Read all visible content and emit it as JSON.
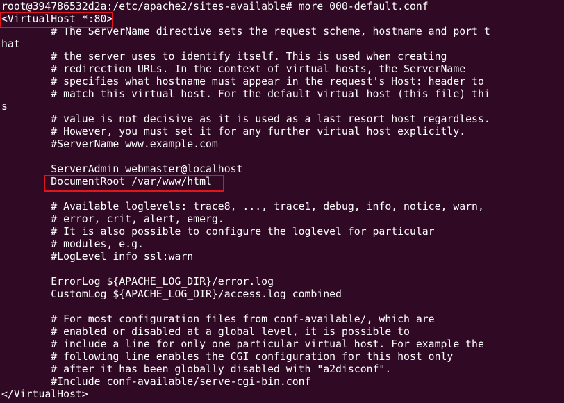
{
  "terminal": {
    "lines": [
      "root@394786532d2a:/etc/apache2/sites-available# more 000-default.conf",
      "<VirtualHost *:80>",
      "        # The ServerName directive sets the request scheme, hostname and port t",
      "hat",
      "        # the server uses to identify itself. This is used when creating",
      "        # redirection URLs. In the context of virtual hosts, the ServerName",
      "        # specifies what hostname must appear in the request's Host: header to",
      "        # match this virtual host. For the default virtual host (this file) thi",
      "s",
      "        # value is not decisive as it is used as a last resort host regardless.",
      "        # However, you must set it for any further virtual host explicitly.",
      "        #ServerName www.example.com",
      "",
      "        ServerAdmin webmaster@localhost",
      "        DocumentRoot /var/www/html",
      "",
      "        # Available loglevels: trace8, ..., trace1, debug, info, notice, warn,",
      "        # error, crit, alert, emerg.",
      "        # It is also possible to configure the loglevel for particular",
      "        # modules, e.g.",
      "        #LogLevel info ssl:warn",
      "",
      "        ErrorLog ${APACHE_LOG_DIR}/error.log",
      "        CustomLog ${APACHE_LOG_DIR}/access.log combined",
      "",
      "        # For most configuration files from conf-available/, which are",
      "        # enabled or disabled at a global level, it is possible to",
      "        # include a line for only one particular virtual host. For example the",
      "        # following line enables the CGI configuration for this host only",
      "        # after it has been globally disabled with \"a2disconf\".",
      "        #Include conf-available/serve-cgi-bin.conf",
      "</VirtualHost>"
    ]
  },
  "colors": {
    "background": "#300a24",
    "text": "#ffffff",
    "highlight": "#e0161b"
  }
}
